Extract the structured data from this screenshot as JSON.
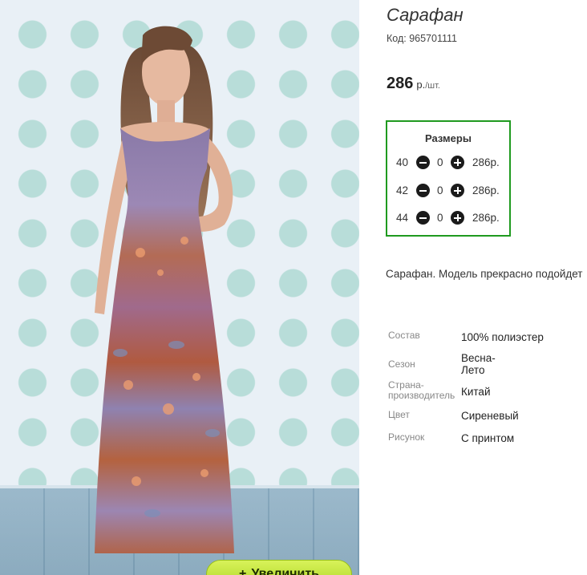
{
  "product": {
    "title": "Сарафан",
    "code": "Код: 965701111",
    "price_value": "286",
    "price_currency": "р.",
    "price_unit": "/шт.",
    "description": "Сарафан. Модель прекрасно подойдет"
  },
  "photo": {
    "zoom_button_label": "Увеличить"
  },
  "sizes": {
    "heading": "Размеры",
    "rows": [
      {
        "size": "40",
        "qty": "0",
        "price": "286р."
      },
      {
        "size": "42",
        "qty": "0",
        "price": "286р."
      },
      {
        "size": "44",
        "qty": "0",
        "price": "286р."
      }
    ]
  },
  "properties": [
    {
      "key": "Состав",
      "value": "100% полиэстер"
    },
    {
      "key": "Сезон",
      "value": "Весна-Лето"
    },
    {
      "key": "Страна-производитель",
      "value": "Китай"
    },
    {
      "key": "Цвет",
      "value": "Сиреневый"
    },
    {
      "key": "Рисунок",
      "value": "С принтом"
    }
  ],
  "colors": {
    "sizes_border": "#1f9a1f",
    "zoom_button": "#b8dc2a"
  },
  "icons": {
    "minus": "minus-circle-icon",
    "plus": "plus-circle-icon"
  }
}
